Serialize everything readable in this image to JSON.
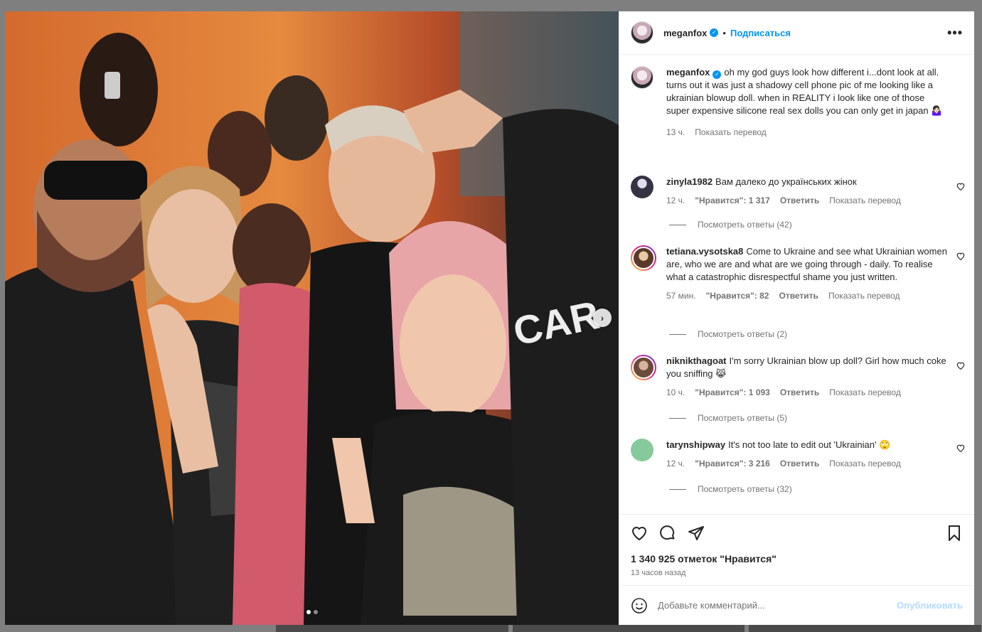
{
  "post": {
    "username": "meganfox",
    "follow_label": "Подписаться",
    "bullet": "•",
    "more_label": "•••",
    "caption": {
      "username": "meganfox",
      "text": "oh my god guys look how different i...dont look at all.\nturns out it was just a shadowy cell phone pic of me looking like a ukrainian blowup doll. when in REALITY i look like one of those super expensive silicone real sex dolls you can only get in japan 🤷🏻‍♀️",
      "time": "13 ч.",
      "translate": "Показать перевод"
    },
    "comments": [
      {
        "username": "zinyla1982",
        "text": "Вам далеко до українських жінок",
        "time": "12 ч.",
        "likes": "\"Нравится\": 1 317",
        "reply": "Ответить",
        "translate": "Показать перевод",
        "view_replies": "Посмотреть ответы (42)",
        "avatar": "av-z",
        "ring": false
      },
      {
        "username": "tetiana.vysotska8",
        "text": "Come to Ukraine and see what Ukrainian women are, who we are and what are we going through - daily. To realise what a catastrophic disrespectful shame you just written.",
        "time": "57 мин.",
        "likes": "\"Нравится\": 82",
        "reply": "Ответить",
        "translate": "Показать перевод",
        "view_replies": "Посмотреть ответы (2)",
        "avatar": "av-t",
        "ring": true
      },
      {
        "username": "niknikthagoat",
        "text": "I'm sorry Ukrainian blow up doll? Girl how much coke you sniffing 😹",
        "time": "10 ч.",
        "likes": "\"Нравится\": 1 093",
        "reply": "Ответить",
        "translate": "Показать перевод",
        "view_replies": "Посмотреть ответы (5)",
        "avatar": "av-n",
        "ring": true
      },
      {
        "username": "tarynshipway",
        "text": "It's not too late to edit out 'Ukrainian' 🙄",
        "time": "12 ч.",
        "likes": "\"Нравится\": 3 216",
        "reply": "Ответить",
        "translate": "Показать перевод",
        "view_replies": "Посмотреть ответы (32)",
        "avatar": "av-ts",
        "ring": false
      }
    ],
    "likes_count": "1 340 925 отметок \"Нравится\"",
    "posted_ago": "13 часов назад",
    "comment_placeholder": "Добавьте комментарий...",
    "publish_label": "Опубликовать",
    "carousel": {
      "current": 1,
      "total": 2,
      "next_label": "›"
    }
  },
  "colors": {
    "link_blue": "#0095f6",
    "muted_text": "#737373",
    "publish_disabled": "#b3dbff"
  }
}
